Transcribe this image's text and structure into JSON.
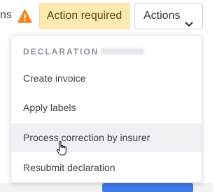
{
  "toolbar": {
    "prev_label_fragment": "ns",
    "warning_icon": "warning-triangle-icon",
    "action_required_label": "Action required",
    "actions_button_label": "Actions",
    "actions_chevron_icon": "chevron-down-icon"
  },
  "dropdown": {
    "header": "DECLARATION",
    "items": [
      {
        "label": "Create invoice"
      },
      {
        "label": "Apply labels"
      },
      {
        "label": "Process correction by insurer",
        "hovered": true
      },
      {
        "label": "Resubmit declaration"
      }
    ]
  },
  "colors": {
    "warning": "#f0861f",
    "badge_background": "#fde9b0",
    "primary_blue": "#3f79e6",
    "hover_background": "#eef0f3"
  }
}
